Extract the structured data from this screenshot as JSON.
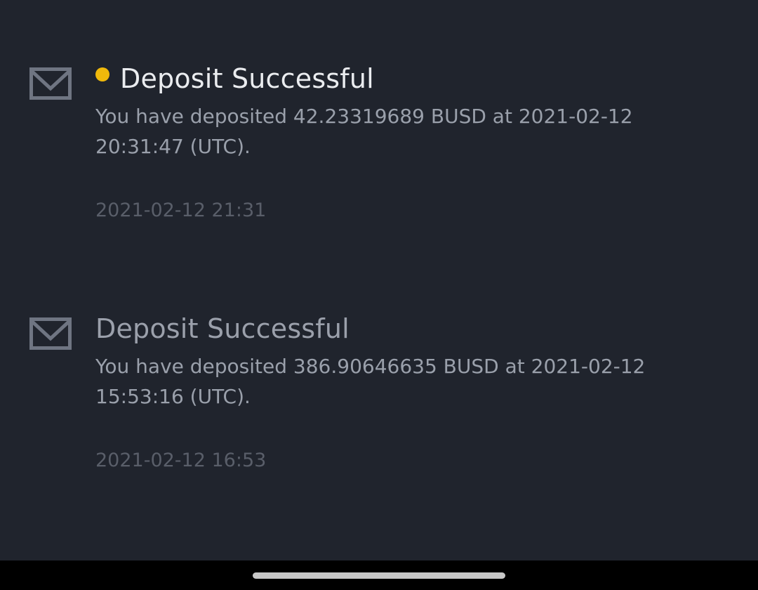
{
  "notifications": [
    {
      "unread": true,
      "title": "Deposit Successful",
      "body": "You have deposited 42.23319689 BUSD at 2021-02-12 20:31:47 (UTC).",
      "time": "2021-02-12 21:31",
      "icon": "mail-icon"
    },
    {
      "unread": false,
      "title": "Deposit Successful",
      "body": "You have deposited 386.90646635 BUSD at 2021-02-12 15:53:16 (UTC).",
      "time": "2021-02-12 16:53",
      "icon": "mail-icon"
    }
  ],
  "colors": {
    "background": "#20242d",
    "unread_dot": "#f0b90b",
    "title_unread": "#eaecef",
    "title_read": "#9ba0ab",
    "body": "#9aa0ab",
    "timestamp": "#595e69"
  }
}
